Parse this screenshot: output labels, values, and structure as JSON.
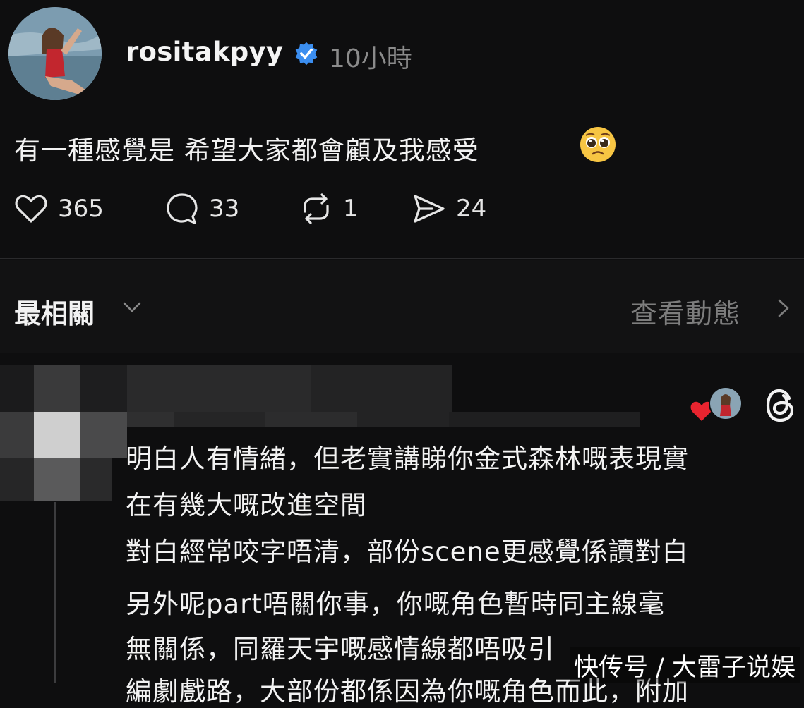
{
  "post": {
    "username": "rositakpyy",
    "time": "10小時",
    "text": "有一種感覺是 希望大家都會顧及我感受",
    "emoji": "pleading-face-emoji",
    "likes": "365",
    "comments": "33",
    "reposts": "1",
    "shares": "24"
  },
  "sort": {
    "label": "最相關",
    "activity": "查看動態"
  },
  "comment": {
    "lines": [
      "明白人有情緒，但老實講睇你金式森林嘅表現實",
      "在有幾大嘅改進空間",
      "對白經常咬字唔清，部份scene更感覺係讀對白",
      "另外呢part唔關你事，你嘅角色暫時同主線毫",
      "無關係，同羅天宇嘅感情線都唔吸引",
      "編劇戲路，大部份都係因為你嘅角色而此，附加"
    ]
  },
  "watermark": "快传号 / 大雷子说娱",
  "colors": {
    "background": "#0e0e0f",
    "verified": "#3b8ef0",
    "heart": "#e8242f",
    "muted_text": "#8b8b8b"
  }
}
